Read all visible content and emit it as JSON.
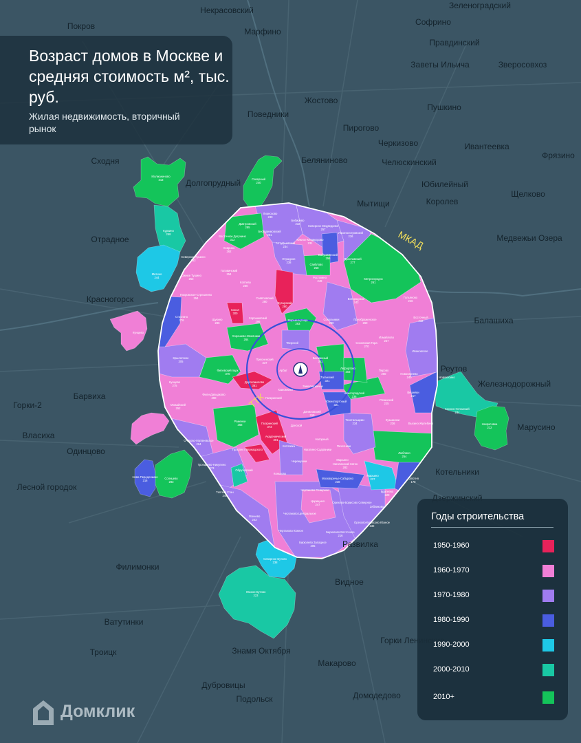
{
  "title": "Возраст домов в Москве и средняя стоимость м², тыс. руб.",
  "subtitle": "Жилая недвижимость, вторичный рынок",
  "legend": {
    "title": "Годы строительства",
    "items": [
      {
        "label": "1950-1960",
        "color": "#e8225a"
      },
      {
        "label": "1960-1970",
        "color": "#f07fd6"
      },
      {
        "label": "1970-1980",
        "color": "#a07cf0"
      },
      {
        "label": "1980-1990",
        "color": "#4a5de0"
      },
      {
        "label": "1990-2000",
        "color": "#1ec8e6"
      },
      {
        "label": "2000-2010",
        "color": "#19c8a4"
      },
      {
        "label": "2010+",
        "color": "#14c45a"
      }
    ]
  },
  "ring_labels": {
    "mkad": "МКАД",
    "ttk": "ТТК"
  },
  "brand": "Домклик",
  "towns": [
    {
      "name": "Некрасовский",
      "pos": [
        330,
        19
      ]
    },
    {
      "name": "Зеленоградский",
      "pos": [
        698,
        12
      ]
    },
    {
      "name": "Покров",
      "pos": [
        118,
        42
      ]
    },
    {
      "name": "Марфино",
      "pos": [
        382,
        50
      ]
    },
    {
      "name": "Правдинский",
      "pos": [
        661,
        66
      ]
    },
    {
      "name": "Софрино",
      "pos": [
        630,
        36
      ]
    },
    {
      "name": "Заветы Ильича",
      "pos": [
        640,
        98
      ]
    },
    {
      "name": "Зверосовхоз",
      "pos": [
        760,
        98
      ]
    },
    {
      "name": "Пушкино",
      "pos": [
        646,
        160
      ]
    },
    {
      "name": "Жостово",
      "pos": [
        467,
        150
      ]
    },
    {
      "name": "Поведники",
      "pos": [
        390,
        170
      ]
    },
    {
      "name": "Пирогово",
      "pos": [
        525,
        190
      ]
    },
    {
      "name": "Черкизово",
      "pos": [
        579,
        212
      ]
    },
    {
      "name": "Ивантеевка",
      "pos": [
        708,
        217
      ]
    },
    {
      "name": "Фрязино",
      "pos": [
        812,
        230
      ]
    },
    {
      "name": "Челюскинский",
      "pos": [
        595,
        240
      ]
    },
    {
      "name": "Беляниново",
      "pos": [
        472,
        237
      ]
    },
    {
      "name": "Сходня",
      "pos": [
        153,
        238
      ]
    },
    {
      "name": "Долгопрудный",
      "pos": [
        310,
        270
      ]
    },
    {
      "name": "Мытищи",
      "pos": [
        543,
        300
      ]
    },
    {
      "name": "Юбилейный",
      "pos": [
        647,
        272
      ]
    },
    {
      "name": "Королев",
      "pos": [
        643,
        297
      ]
    },
    {
      "name": "Щелково",
      "pos": [
        768,
        286
      ]
    },
    {
      "name": "Отрадное",
      "pos": [
        160,
        352
      ]
    },
    {
      "name": "Медвежьи Озера",
      "pos": [
        770,
        350
      ]
    },
    {
      "name": "Красногорск",
      "pos": [
        160,
        439
      ]
    },
    {
      "name": "Балашиха",
      "pos": [
        718,
        470
      ]
    },
    {
      "name": "Реутов",
      "pos": [
        660,
        540
      ]
    },
    {
      "name": "Железнодорожный",
      "pos": [
        748,
        562
      ]
    },
    {
      "name": "Барвиха",
      "pos": [
        130,
        580
      ]
    },
    {
      "name": "Горки-2",
      "pos": [
        40,
        593
      ]
    },
    {
      "name": "Власиха",
      "pos": [
        56,
        637
      ]
    },
    {
      "name": "Одинцово",
      "pos": [
        125,
        660
      ]
    },
    {
      "name": "Лесной городок",
      "pos": [
        68,
        712
      ]
    },
    {
      "name": "Филимонки",
      "pos": [
        200,
        828
      ]
    },
    {
      "name": "Ватутинки",
      "pos": [
        180,
        908
      ]
    },
    {
      "name": "Троицк",
      "pos": [
        150,
        952
      ]
    },
    {
      "name": "Видное",
      "pos": [
        508,
        850
      ]
    },
    {
      "name": "Горки Ленинские",
      "pos": [
        600,
        935
      ]
    },
    {
      "name": "Развилка",
      "pos": [
        524,
        795
      ]
    },
    {
      "name": "Знамя Октября",
      "pos": [
        380,
        950
      ]
    },
    {
      "name": "Дубровицы",
      "pos": [
        325,
        1000
      ]
    },
    {
      "name": "Подольск",
      "pos": [
        370,
        1020
      ]
    },
    {
      "name": "Домодедово",
      "pos": [
        548,
        1015
      ]
    },
    {
      "name": "Макарово",
      "pos": [
        490,
        968
      ]
    },
    {
      "name": "Марусино",
      "pos": [
        780,
        625
      ]
    },
    {
      "name": "Дзержинский",
      "pos": [
        665,
        728
      ]
    },
    {
      "name": "Котельники",
      "pos": [
        665,
        690
      ]
    }
  ],
  "districts": [
    {
      "name": "Молжаниново",
      "price": "313",
      "color": "#14c45a",
      "pos": [
        234,
        258
      ]
    },
    {
      "name": "Северный",
      "price": "240",
      "color": "#14c45a",
      "pos": [
        376,
        262
      ]
    },
    {
      "name": "Куркино",
      "price": "258",
      "color": "#19c8a4",
      "pos": [
        245,
        337
      ]
    },
    {
      "name": "Митино",
      "price": "244",
      "color": "#1ec8e6",
      "pos": [
        228,
        400
      ]
    },
    {
      "name": "Лианозово",
      "price": "230",
      "color": "#a07cf0",
      "pos": [
        393,
        312
      ]
    },
    {
      "name": "Бибирево",
      "price": "232",
      "color": "#a07cf0",
      "pos": [
        433,
        322
      ]
    },
    {
      "name": "Северное Медведково",
      "price": "257",
      "color": "#a07cf0",
      "pos": [
        470,
        330
      ]
    },
    {
      "name": "Лосиноостровский",
      "price": "226",
      "color": "#a07cf0",
      "pos": [
        510,
        340
      ]
    },
    {
      "name": "Дмитровский",
      "price": "285",
      "color": "#14c45a",
      "pos": [
        360,
        327
      ]
    },
    {
      "name": "Восточное Дегунино",
      "price": "312",
      "color": "#14c45a",
      "pos": [
        338,
        345
      ]
    },
    {
      "name": "Бескудниковский",
      "price": "261",
      "color": "#f07fd6",
      "pos": [
        392,
        338
      ]
    },
    {
      "name": "Алтуфьевский",
      "price": "234",
      "color": "#a07cf0",
      "pos": [
        415,
        355
      ]
    },
    {
      "name": "Южное Медведково",
      "price": "231",
      "color": "#a07cf0",
      "pos": [
        451,
        350
      ]
    },
    {
      "name": "Бабушкинский",
      "price": "256",
      "color": "#4a5de0",
      "pos": [
        477,
        372
      ]
    },
    {
      "name": "Ховрино",
      "price": "262",
      "color": "#f07fd6",
      "pos": [
        333,
        362
      ]
    },
    {
      "name": "Северное Тушино",
      "price": "253",
      "color": "#f07fd6",
      "pos": [
        281,
        375
      ]
    },
    {
      "name": "Отрадное",
      "price": "238",
      "color": "#a07cf0",
      "pos": [
        420,
        378
      ]
    },
    {
      "name": "Свиблово",
      "price": "258",
      "color": "#14c45a",
      "pos": [
        460,
        386
      ]
    },
    {
      "name": "Ярославский",
      "price": "277",
      "color": "#a07cf0",
      "pos": [
        513,
        378
      ]
    },
    {
      "name": "Головинский",
      "price": "254",
      "color": "#f07fd6",
      "pos": [
        333,
        395
      ]
    },
    {
      "name": "Южное Тушино",
      "price": "253",
      "color": "#f07fd6",
      "pos": [
        278,
        402
      ]
    },
    {
      "name": "Ростокино",
      "price": "249",
      "color": "#f07fd6",
      "pos": [
        465,
        405
      ]
    },
    {
      "name": "Метрогородок",
      "price": "261",
      "color": "#14c45a",
      "pos": [
        543,
        407
      ]
    },
    {
      "name": "Покровское-Стрешнево",
      "price": "254",
      "color": "#f07fd6",
      "pos": [
        285,
        430
      ]
    },
    {
      "name": "Коптево",
      "price": "260",
      "color": "#f07fd6",
      "pos": [
        357,
        412
      ]
    },
    {
      "name": "Савёловский",
      "price": "280",
      "color": "#f07fd6",
      "pos": [
        385,
        435
      ]
    },
    {
      "name": "Богородское",
      "price": "243",
      "color": "#f07fd6",
      "pos": [
        518,
        436
      ]
    },
    {
      "name": "Гольяново",
      "price": "246",
      "color": "#f07fd6",
      "pos": [
        597,
        434
      ]
    },
    {
      "name": "Сокол",
      "price": "300",
      "color": "#e8225a",
      "pos": [
        342,
        452
      ]
    },
    {
      "name": "Бутырский",
      "price": "280",
      "color": "#f07fd6",
      "pos": [
        414,
        442
      ]
    },
    {
      "name": "Марьина роща",
      "price": "293",
      "color": "#14c45a",
      "pos": [
        433,
        467
      ]
    },
    {
      "name": "Сокольники",
      "price": "290",
      "color": "#a07cf0",
      "pos": [
        482,
        466
      ]
    },
    {
      "name": "Преображенское",
      "price": "260",
      "color": "#f07fd6",
      "pos": [
        531,
        466
      ]
    },
    {
      "name": "Восточный",
      "price": "232",
      "color": "#f07fd6",
      "pos": [
        612,
        463
      ]
    },
    {
      "name": "Строгино",
      "price": "276",
      "color": "#4a5de0",
      "pos": [
        264,
        462
      ]
    },
    {
      "name": "Щукино",
      "price": "286",
      "color": "#f07fd6",
      "pos": [
        316,
        466
      ]
    },
    {
      "name": "Хорошевский",
      "price": "296",
      "color": "#f07fd6",
      "pos": [
        375,
        464
      ]
    },
    {
      "name": "Хорошево-Мневники",
      "price": "264",
      "color": "#14c45a",
      "pos": [
        358,
        490
      ]
    },
    {
      "name": "Измайлово",
      "price": "257",
      "color": "#f07fd6",
      "pos": [
        562,
        492
      ]
    },
    {
      "name": "Соколиная Гора",
      "price": "270",
      "color": "#f07fd6",
      "pos": [
        533,
        500
      ]
    },
    {
      "name": "Кунцево",
      "price": "",
      "color": "#f07fd6",
      "pos": [
        201,
        485
      ]
    },
    {
      "name": "Тверской",
      "price": "",
      "color": "#a07cf0",
      "pos": [
        425,
        500
      ]
    },
    {
      "name": "Басманный",
      "price": "341",
      "color": "#14c45a",
      "pos": [
        466,
        522
      ]
    },
    {
      "name": "Ивановское",
      "price": "",
      "color": "#a07cf0",
      "pos": [
        611,
        512
      ]
    },
    {
      "name": "Крылатское",
      "price": "305",
      "color": "#a07cf0",
      "pos": [
        263,
        522
      ]
    },
    {
      "name": "Пресненский",
      "price": "337",
      "color": "#f07fd6",
      "pos": [
        385,
        524
      ]
    },
    {
      "name": "Филевский парк",
      "price": "370",
      "color": "#14c45a",
      "pos": [
        331,
        540
      ]
    },
    {
      "name": "Арбат",
      "price": "",
      "color": "#f07fd6",
      "pos": [
        412,
        540
      ]
    },
    {
      "name": "Лефортово",
      "price": "303",
      "color": "#14c45a",
      "pos": [
        506,
        537
      ]
    },
    {
      "name": "Перово",
      "price": "260",
      "color": "#f07fd6",
      "pos": [
        558,
        540
      ]
    },
    {
      "name": "Новогиреево",
      "price": "240",
      "color": "#f07fd6",
      "pos": [
        595,
        545
      ]
    },
    {
      "name": "Таганский",
      "price": "321",
      "color": "#4a5de0",
      "pos": [
        476,
        550
      ]
    },
    {
      "name": "Дорогомилово",
      "price": "361",
      "color": "#e8225a",
      "pos": [
        370,
        557
      ]
    },
    {
      "name": "Кунцево",
      "price": "275",
      "color": "#f07fd6",
      "pos": [
        254,
        557
      ]
    },
    {
      "name": "Хамовники",
      "price": "",
      "color": "#f07fd6",
      "pos": [
        415,
        568
      ]
    },
    {
      "name": "Замоскворечье",
      "price": "",
      "color": "#f07fd6",
      "pos": [
        455,
        563
      ]
    },
    {
      "name": "Нижегородский",
      "price": "236",
      "color": "#14c45a",
      "pos": [
        515,
        573
      ]
    },
    {
      "name": "Вешняки",
      "price": "217",
      "color": "#4a5de0",
      "pos": [
        601,
        572
      ]
    },
    {
      "name": "Рязанский",
      "price": "225",
      "color": "#f07fd6",
      "pos": [
        562,
        583
      ]
    },
    {
      "name": "Фили-Давыдково",
      "price": "290",
      "color": "#f07fd6",
      "pos": [
        311,
        575
      ]
    },
    {
      "name": "Гагаринский",
      "price": "",
      "color": "#f07fd6",
      "pos": [
        398,
        580
      ]
    },
    {
      "name": "Даниловский",
      "price": "319",
      "color": "#f07fd6",
      "pos": [
        454,
        600
      ]
    },
    {
      "name": "Южнопортовый",
      "price": "321",
      "color": "#4a5de0",
      "pos": [
        489,
        585
      ]
    },
    {
      "name": "Можайский",
      "price": "252",
      "color": "#f07fd6",
      "pos": [
        259,
        590
      ]
    },
    {
      "name": "Текстильщики",
      "price": "234",
      "color": "#a07cf0",
      "pos": [
        516,
        612
      ]
    },
    {
      "name": "Кузьминки",
      "price": "236",
      "color": "#f07fd6",
      "pos": [
        571,
        612
      ]
    },
    {
      "name": "Выхино-Жулебино",
      "price": "",
      "color": "#f07fd6",
      "pos": [
        612,
        617
      ]
    },
    {
      "name": "Раменки",
      "price": "368",
      "color": "#14c45a",
      "pos": [
        349,
        614
      ]
    },
    {
      "name": "Гагаринский",
      "price": "373",
      "color": "#e8225a",
      "pos": [
        392,
        617
      ]
    },
    {
      "name": "Академический",
      "price": "301",
      "color": "#e8225a",
      "pos": [
        401,
        636
      ]
    },
    {
      "name": "Донской",
      "price": "",
      "color": "#f07fd6",
      "pos": [
        431,
        620
      ]
    },
    {
      "name": "Очаково-Матвеевское",
      "price": "264",
      "color": "#a07cf0",
      "pos": [
        289,
        642
      ]
    },
    {
      "name": "Котловка",
      "price": "",
      "color": "#a07cf0",
      "pos": [
        420,
        650
      ]
    },
    {
      "name": "Нагатино-Садовники",
      "price": "",
      "color": "#f07fd6",
      "pos": [
        462,
        655
      ]
    },
    {
      "name": "Нагорный",
      "price": "",
      "color": "#f07fd6",
      "pos": [
        468,
        640
      ]
    },
    {
      "name": "Печатники",
      "price": "",
      "color": "#a07cf0",
      "pos": [
        500,
        650
      ]
    },
    {
      "name": "Марьино",
      "price": "",
      "color": "#f07fd6",
      "pos": [
        498,
        670
      ]
    },
    {
      "name": "Люблино",
      "price": "254",
      "color": "#14c45a",
      "pos": [
        588,
        660
      ]
    },
    {
      "name": "Нагатинский Затон",
      "price": "282",
      "color": "#f07fd6",
      "pos": [
        502,
        676
      ]
    },
    {
      "name": "Проспект Вернадского",
      "price": "",
      "color": "#e8225a",
      "pos": [
        360,
        655
      ]
    },
    {
      "name": "Черемушки",
      "price": "",
      "color": "#a07cf0",
      "pos": [
        435,
        672
      ]
    },
    {
      "name": "Тропарёво-Никулино",
      "price": "273",
      "color": "#a07cf0",
      "pos": [
        308,
        677
      ]
    },
    {
      "name": "Обручевский",
      "price": "",
      "color": "#19c8a4",
      "pos": [
        355,
        685
      ]
    },
    {
      "name": "Москворечье-Сабурово",
      "price": "238",
      "color": "#4a5de0",
      "pos": [
        491,
        697
      ]
    },
    {
      "name": "Капотня",
      "price": "178",
      "color": "#4a5de0",
      "pos": [
        601,
        697
      ]
    },
    {
      "name": "Марьино",
      "price": "237",
      "color": "#1ec8e6",
      "pos": [
        542,
        693
      ]
    },
    {
      "name": "Солнцево",
      "price": "283",
      "color": "#14c45a",
      "pos": [
        249,
        697
      ]
    },
    {
      "name": "Ново-Переделкино",
      "price": "216",
      "color": "#4a5de0",
      "pos": [
        211,
        695
      ]
    },
    {
      "name": "Коньково",
      "price": "",
      "color": "#f07fd6",
      "pos": [
        407,
        690
      ]
    },
    {
      "name": "Теплый Стан",
      "price": "244",
      "color": "#a07cf0",
      "pos": [
        327,
        717
      ]
    },
    {
      "name": "Братеево",
      "price": "229",
      "color": "#a07cf0",
      "pos": [
        563,
        716
      ]
    },
    {
      "name": "Чертаново Северное",
      "price": "",
      "color": "#a07cf0",
      "pos": [
        458,
        714
      ]
    },
    {
      "name": "Царицыно",
      "price": "247",
      "color": "#f07fd6",
      "pos": [
        462,
        730
      ]
    },
    {
      "name": "Орехово-Борисово Северное",
      "price": "",
      "color": "#a07cf0",
      "pos": [
        512,
        732
      ]
    },
    {
      "name": "Зябликово",
      "price": "",
      "color": "#a07cf0",
      "pos": [
        548,
        738
      ]
    },
    {
      "name": "Ясенево",
      "price": "243",
      "color": "#a07cf0",
      "pos": [
        370,
        752
      ]
    },
    {
      "name": "Чертаново Центральное",
      "price": "",
      "color": "#a07cf0",
      "pos": [
        436,
        748
      ]
    },
    {
      "name": "Орехово-Борисово Южное",
      "price": "232",
      "color": "#a07cf0",
      "pos": [
        541,
        761
      ]
    },
    {
      "name": "Чертаново Южное",
      "price": "",
      "color": "#a07cf0",
      "pos": [
        423,
        773
      ]
    },
    {
      "name": "Бирюлево Восточное",
      "price": "216",
      "color": "#a07cf0",
      "pos": [
        495,
        775
      ]
    },
    {
      "name": "Бирюлево Западное",
      "price": "205",
      "color": "#a07cf0",
      "pos": [
        455,
        790
      ]
    },
    {
      "name": "Северное Бутово",
      "price": "238",
      "color": "#1ec8e6",
      "pos": [
        400,
        814
      ]
    },
    {
      "name": "Южное Бутово",
      "price": "223",
      "color": "#19c8a4",
      "pos": [
        372,
        862
      ]
    },
    {
      "name": "Косино-Ухтомский",
      "price": "234",
      "color": "#19c8a4",
      "pos": [
        665,
        596
      ]
    },
    {
      "name": "Некрасовка",
      "price": "212",
      "color": "#14c45a",
      "pos": [
        712,
        618
      ]
    },
    {
      "name": "Новокосино",
      "price": "",
      "color": "#19c8a4",
      "pos": [
        650,
        550
      ]
    }
  ]
}
